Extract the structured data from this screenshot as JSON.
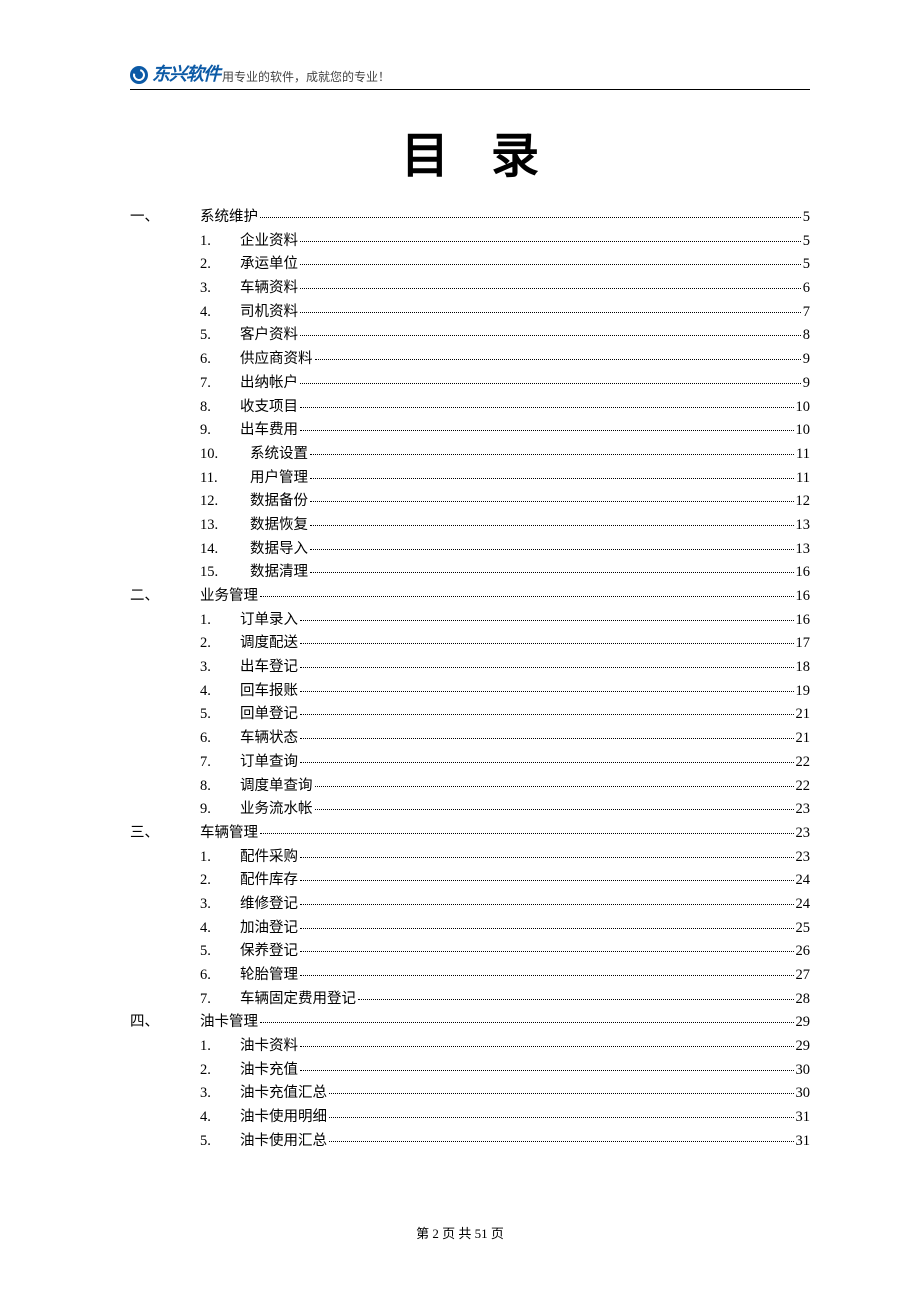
{
  "header": {
    "logo_text": "东兴软件",
    "slogan": "用专业的软件，成就您的专业！"
  },
  "title": "目录",
  "toc": [
    {
      "section_marker": "一、",
      "label": "系统维护",
      "page": "5",
      "children": [
        {
          "marker": "1.",
          "label": "企业资料",
          "page": "5"
        },
        {
          "marker": "2.",
          "label": "承运单位",
          "page": "5"
        },
        {
          "marker": "3.",
          "label": "车辆资料",
          "page": "6"
        },
        {
          "marker": "4.",
          "label": "司机资料",
          "page": "7"
        },
        {
          "marker": "5.",
          "label": "客户资料",
          "page": "8"
        },
        {
          "marker": "6.",
          "label": "供应商资料",
          "page": "9"
        },
        {
          "marker": "7.",
          "label": "出纳帐户",
          "page": "9"
        },
        {
          "marker": "8.",
          "label": "收支项目",
          "page": "10"
        },
        {
          "marker": "9.",
          "label": "出车费用",
          "page": "10"
        },
        {
          "marker": "10.",
          "label": "系统设置",
          "page": "11",
          "extra_indent": true
        },
        {
          "marker": "11.",
          "label": "用户管理",
          "page": "11",
          "extra_indent": true
        },
        {
          "marker": "12.",
          "label": "数据备份",
          "page": "12",
          "extra_indent": true
        },
        {
          "marker": "13.",
          "label": "数据恢复",
          "page": "13",
          "extra_indent": true
        },
        {
          "marker": "14.",
          "label": "数据导入",
          "page": "13",
          "extra_indent": true
        },
        {
          "marker": "15.",
          "label": "数据清理",
          "page": "16",
          "extra_indent": true
        }
      ]
    },
    {
      "section_marker": "二、",
      "label": "业务管理",
      "page": "16",
      "children": [
        {
          "marker": "1.",
          "label": "订单录入",
          "page": "16"
        },
        {
          "marker": "2.",
          "label": "调度配送",
          "page": "17"
        },
        {
          "marker": "3.",
          "label": "出车登记",
          "page": "18"
        },
        {
          "marker": "4.",
          "label": "回车报账",
          "page": "19"
        },
        {
          "marker": "5.",
          "label": "回单登记",
          "page": "21"
        },
        {
          "marker": "6.",
          "label": "车辆状态",
          "page": "21"
        },
        {
          "marker": "7.",
          "label": "订单查询",
          "page": "22"
        },
        {
          "marker": "8.",
          "label": "调度单查询",
          "page": "22"
        },
        {
          "marker": "9.",
          "label": "业务流水帐",
          "page": "23"
        }
      ]
    },
    {
      "section_marker": "三、",
      "label": "车辆管理",
      "page": "23",
      "children": [
        {
          "marker": "1.",
          "label": "配件采购",
          "page": "23"
        },
        {
          "marker": "2.",
          "label": "配件库存",
          "page": "24"
        },
        {
          "marker": "3.",
          "label": "维修登记",
          "page": "24"
        },
        {
          "marker": "4.",
          "label": "加油登记",
          "page": "25"
        },
        {
          "marker": "5.",
          "label": "保养登记",
          "page": "26"
        },
        {
          "marker": "6.",
          "label": "轮胎管理",
          "page": "27"
        },
        {
          "marker": "7.",
          "label": "车辆固定费用登记",
          "page": "28"
        }
      ]
    },
    {
      "section_marker": "四、",
      "label": "油卡管理",
      "page": "29",
      "children": [
        {
          "marker": "1.",
          "label": "油卡资料",
          "page": "29"
        },
        {
          "marker": "2.",
          "label": "油卡充值",
          "page": "30"
        },
        {
          "marker": "3.",
          "label": "油卡充值汇总",
          "page": "30"
        },
        {
          "marker": "4.",
          "label": "油卡使用明细",
          "page": "31"
        },
        {
          "marker": "5.",
          "label": "油卡使用汇总",
          "page": "31"
        }
      ]
    }
  ],
  "footer": {
    "prefix": "第 ",
    "current": "2",
    "mid": " 页 共 ",
    "total": "51",
    "suffix": " 页"
  }
}
